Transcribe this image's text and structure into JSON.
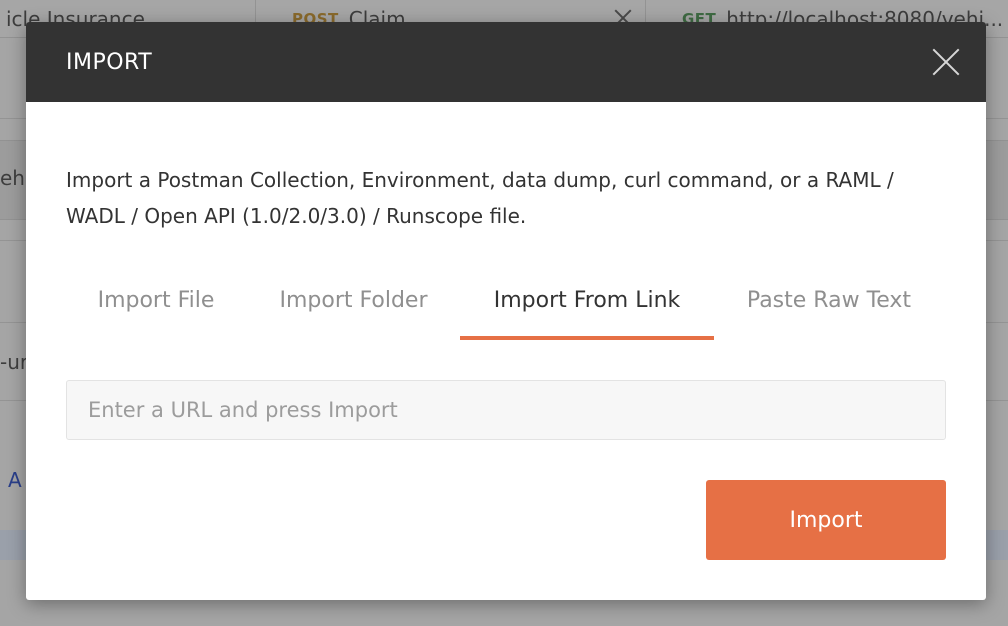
{
  "background": {
    "tabs": [
      {
        "label": "icle Insurance"
      },
      {
        "method": "POST",
        "label": "Claim"
      },
      {
        "method": "GET",
        "label": "http://localhost:8080/vehi..."
      }
    ],
    "left_fragments": [
      "eh",
      "-ur",
      "A"
    ]
  },
  "modal": {
    "title": "IMPORT",
    "description": "Import a Postman Collection, Environment, data dump, curl command, or a RAML / WADL / Open API (1.0/2.0/3.0) / Runscope file.",
    "tabs": [
      {
        "label": "Import File",
        "active": false
      },
      {
        "label": "Import Folder",
        "active": false
      },
      {
        "label": "Import From Link",
        "active": true
      },
      {
        "label": "Paste Raw Text",
        "active": false
      }
    ],
    "url_input": {
      "placeholder": "Enter a URL and press Import",
      "value": ""
    },
    "import_button_label": "Import"
  },
  "colors": {
    "accent": "#e67045",
    "header_bg": "#333333",
    "overlay": "#a5a5a5"
  }
}
